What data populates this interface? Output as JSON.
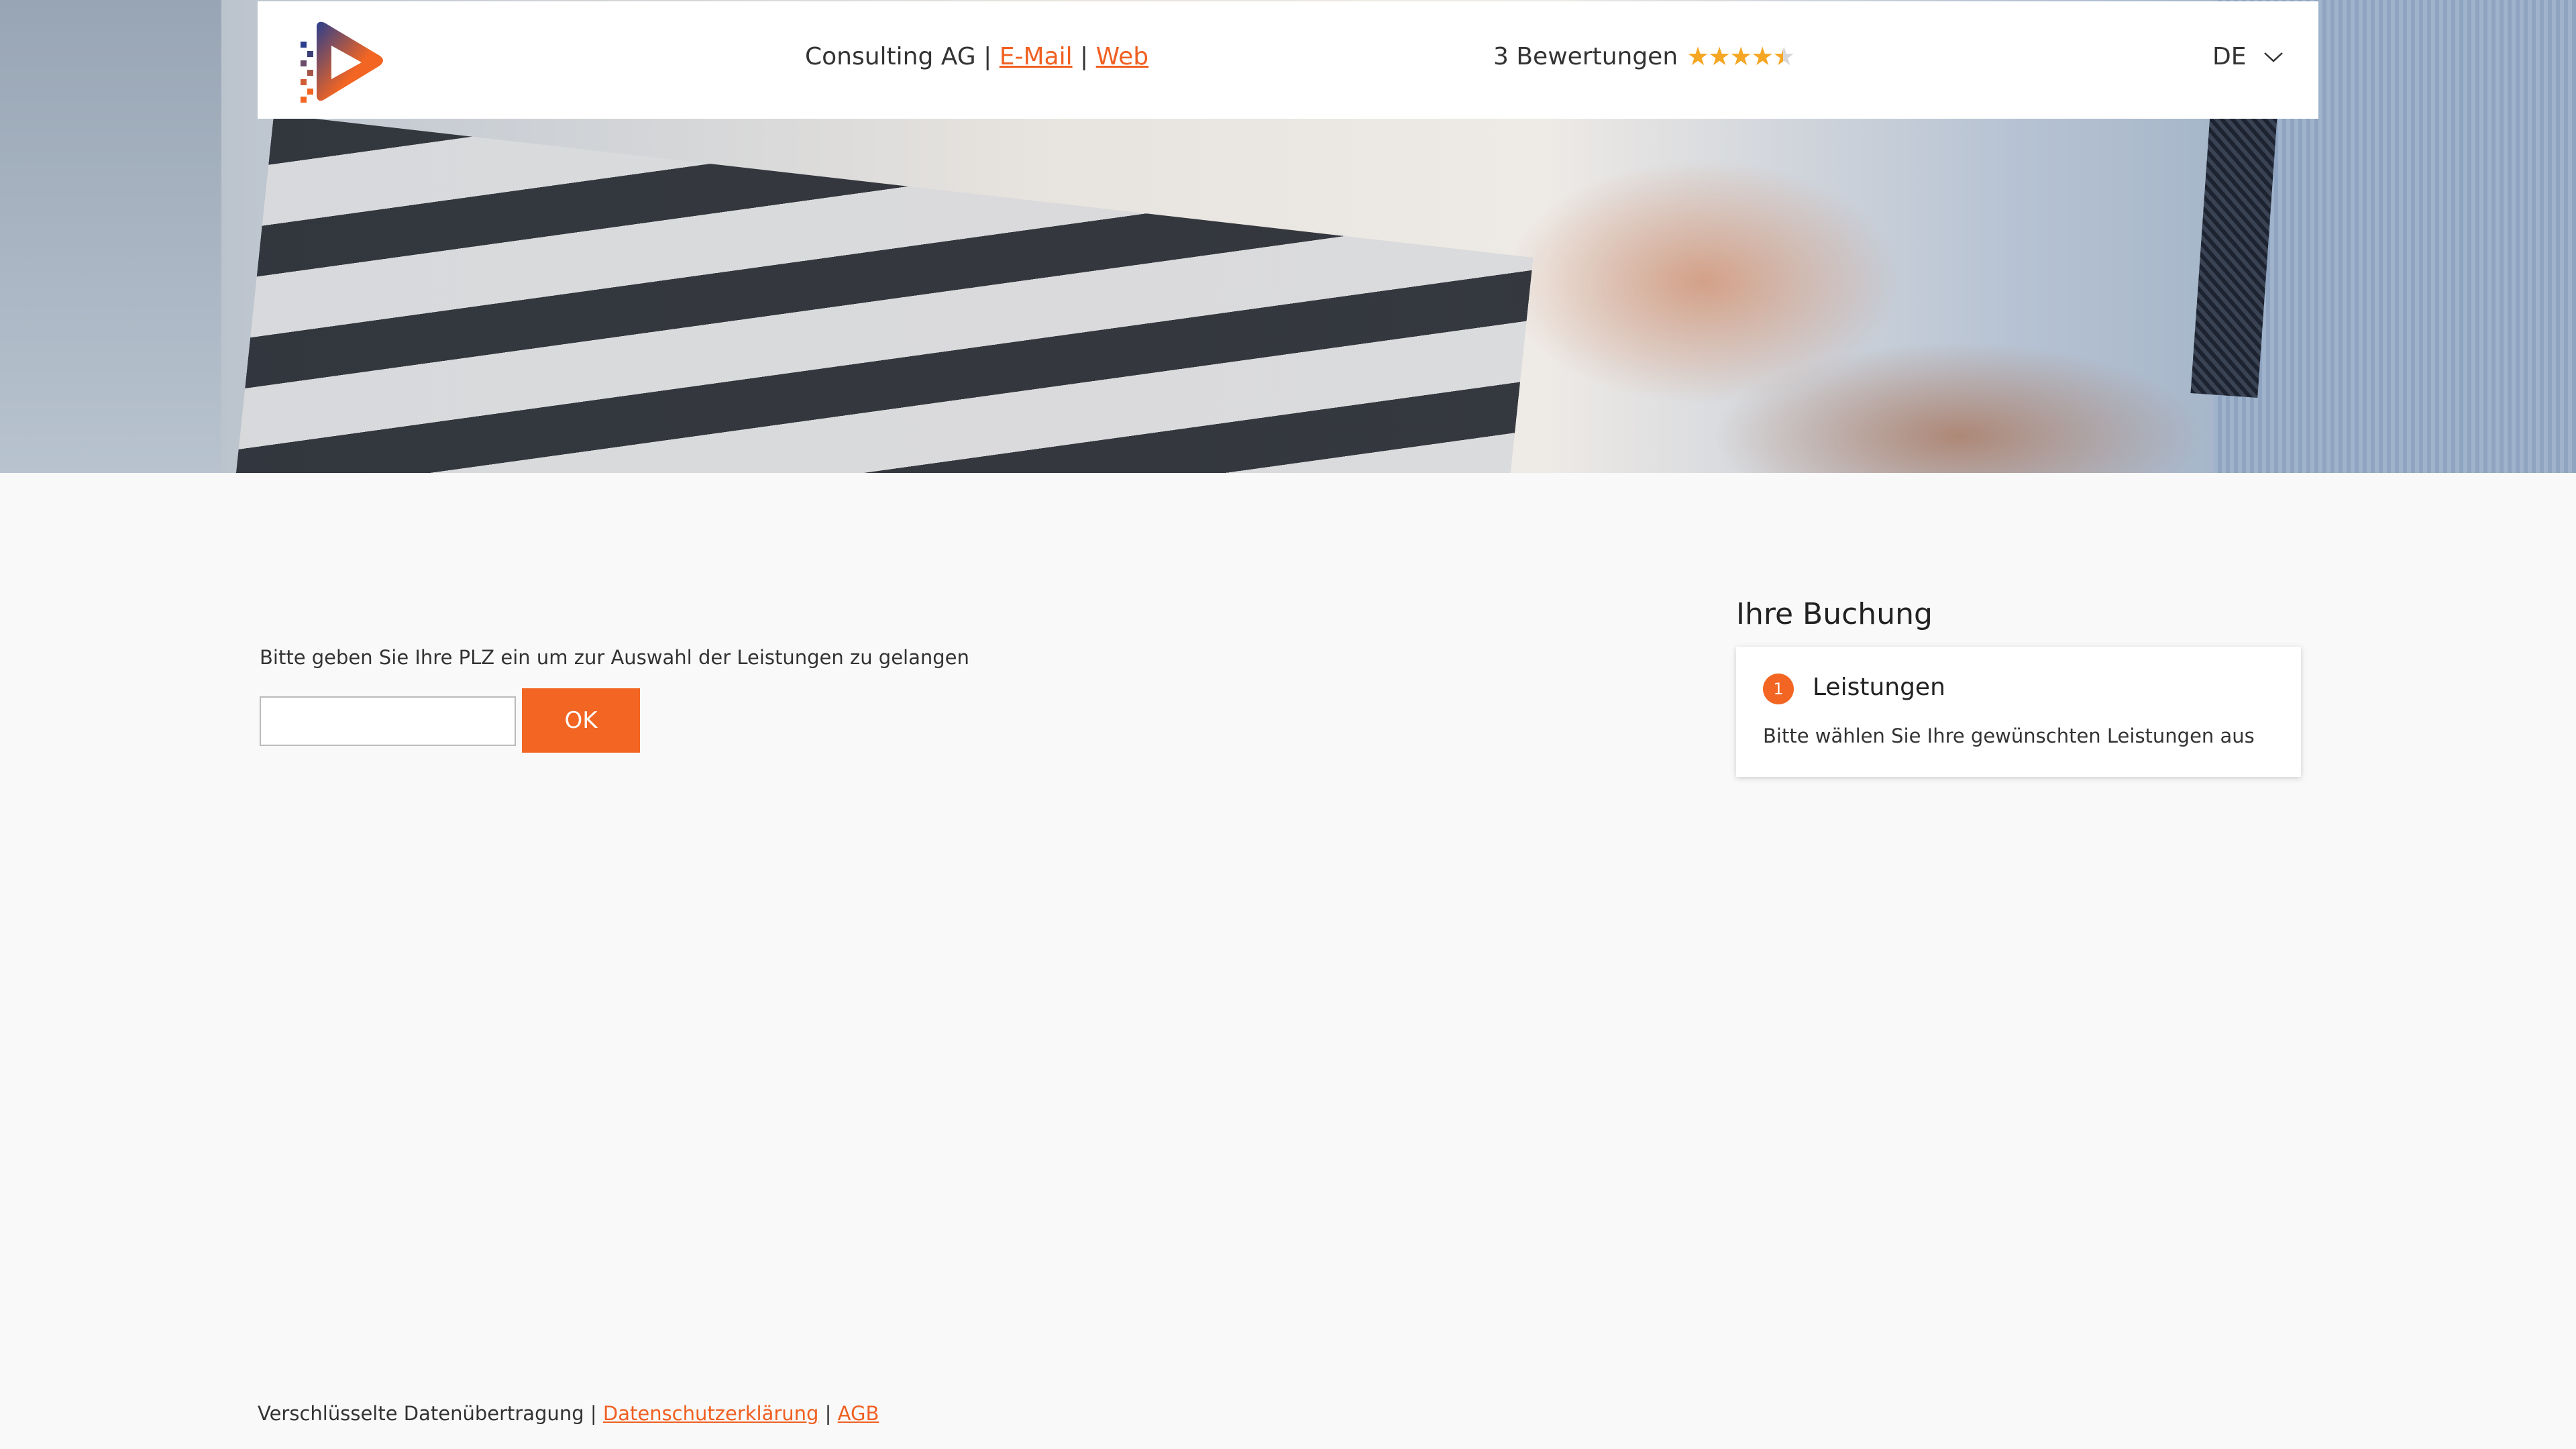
{
  "header": {
    "company_name": "Consulting AG",
    "separator": "|",
    "email_link": "E-Mail",
    "web_link": "Web",
    "reviews_text": "3 Bewertungen",
    "rating": 4.5,
    "rating_max": 5,
    "language": "DE",
    "logo_icon": "play-logo-icon",
    "chevron_icon": "chevron-down-icon"
  },
  "hero": {
    "image_description_icon": "handshake-image"
  },
  "main": {
    "prompt": "Bitte geben Sie Ihre PLZ ein um zur Auswahl der Leistungen zu gelangen",
    "plz_value": "",
    "ok_label": "OK"
  },
  "booking": {
    "title": "Ihre Buchung",
    "step_number": "1",
    "step_title": "Leistungen",
    "step_description": "Bitte wählen Sie Ihre gewünschten Leistungen aus"
  },
  "footer": {
    "encrypted": "Verschlüsselte Datenübertragung",
    "separator": "|",
    "privacy_link": "Datenschutzerklärung",
    "terms_link": "AGB"
  },
  "colors": {
    "accent": "#f26522",
    "star": "#f5a623",
    "logo_blue": "#2b3f8c"
  }
}
